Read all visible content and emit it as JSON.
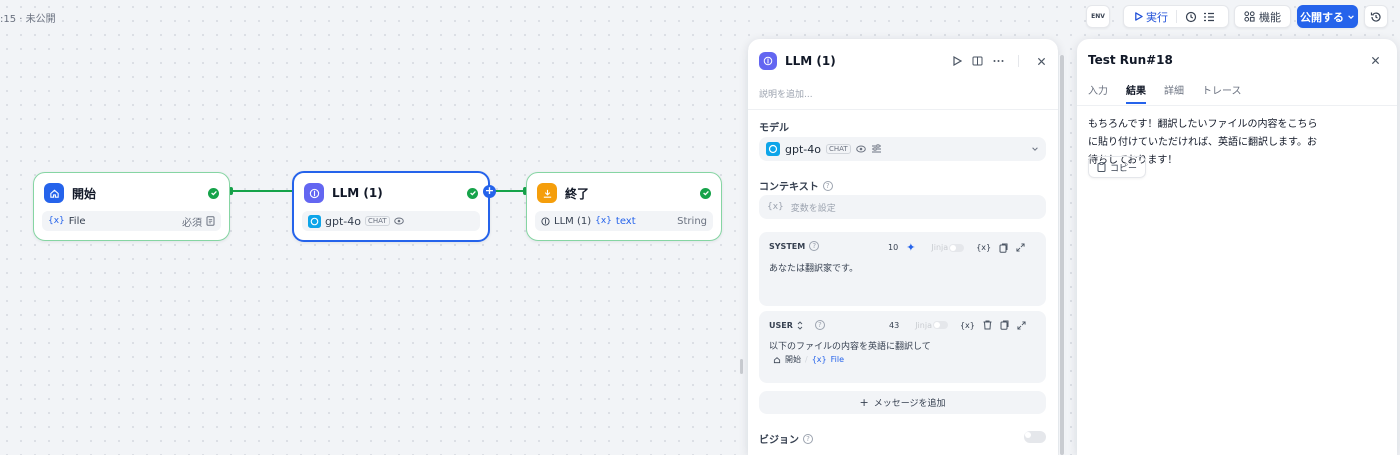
{
  "status": ":15 · 未公開",
  "toolbar": {
    "env_label": "ENV",
    "run_label": "実行",
    "features_label": "機能",
    "publish_label": "公開する"
  },
  "nodes": {
    "start": {
      "title": "開始",
      "var": "File",
      "required": "必須"
    },
    "llm": {
      "title": "LLM (1)",
      "model": "gpt-4o",
      "chip": "CHAT"
    },
    "end": {
      "title": "終了",
      "source": "LLM (1)",
      "var": "text",
      "type": "String"
    }
  },
  "config": {
    "title": "LLM (1)",
    "description_placeholder": "説明を追加...",
    "model_label": "モデル",
    "model_name": "gpt-4o",
    "model_chip": "CHAT",
    "context_label": "コンテキスト",
    "context_placeholder": "変数を設定",
    "system": {
      "role": "SYSTEM",
      "tokens": "10",
      "jinja": "Jinja",
      "text": "あなたは翻訳家です。"
    },
    "user": {
      "role": "USER",
      "tokens": "43",
      "jinja": "Jinja",
      "text": "以下のファイルの内容を英語に翻訳して",
      "ref_node": "開始",
      "ref_var": "File"
    },
    "add_message": "メッセージを追加",
    "vision_label": "ビジョン"
  },
  "testrun": {
    "title": "Test Run#18",
    "tabs": [
      "入力",
      "結果",
      "詳細",
      "トレース"
    ],
    "active_tab": 1,
    "result_text": "もちろんです！翻訳したいファイルの内容をこちらに貼り付けていただければ、英語に翻訳します。お待ちしております！",
    "copy_label": "コピー"
  },
  "colors": {
    "accent": "#2563eb",
    "success": "#16a34a",
    "start_icon": "#2563eb",
    "llm_icon": "#6366f1",
    "end_icon": "#f59e0b"
  }
}
